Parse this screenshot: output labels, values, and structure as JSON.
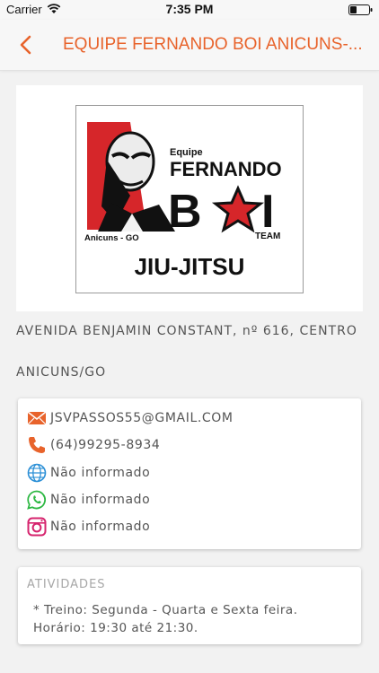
{
  "status_bar": {
    "carrier": "Carrier",
    "time": "7:35 PM",
    "icons": [
      "wifi-icon",
      "battery-icon"
    ]
  },
  "nav": {
    "title": "EQUIPE FERNANDO BOI ANICUNS-...",
    "back_icon": "chevron-left-icon",
    "accent_color": "#e8632b"
  },
  "logo": {
    "line_equipe": "Equipe",
    "line_fernando": "FERNANDO",
    "location": "Anicuns - GO",
    "boi": "B",
    "boi_end": "I",
    "team": "TEAM",
    "sport": "JIU-JITSU",
    "colors": {
      "red": "#d6262a",
      "black": "#111111"
    }
  },
  "address": {
    "street": "AVENIDA BENJAMIN CONSTANT, nº 616, CENTRO",
    "city": "ANICUNS/GO"
  },
  "contacts": [
    {
      "icon": "envelope-icon",
      "color": "#e8632b",
      "text": "JSVPASSOS55@GMAIL.COM"
    },
    {
      "icon": "phone-icon",
      "color": "#e8632b",
      "text": "(64)99295-8934"
    },
    {
      "icon": "globe-icon",
      "color": "#2b8fd6",
      "text": "Não informado"
    },
    {
      "icon": "whatsapp-icon",
      "color": "#2cb742",
      "text": "Não informado"
    },
    {
      "icon": "instagram-icon",
      "color": "#d6246e",
      "text": "Não informado"
    }
  ],
  "activities": {
    "title": "ATIVIDADES",
    "text": "* Treino: Segunda - Quarta e Sexta feira. Horário: 19:30 até 21:30."
  }
}
